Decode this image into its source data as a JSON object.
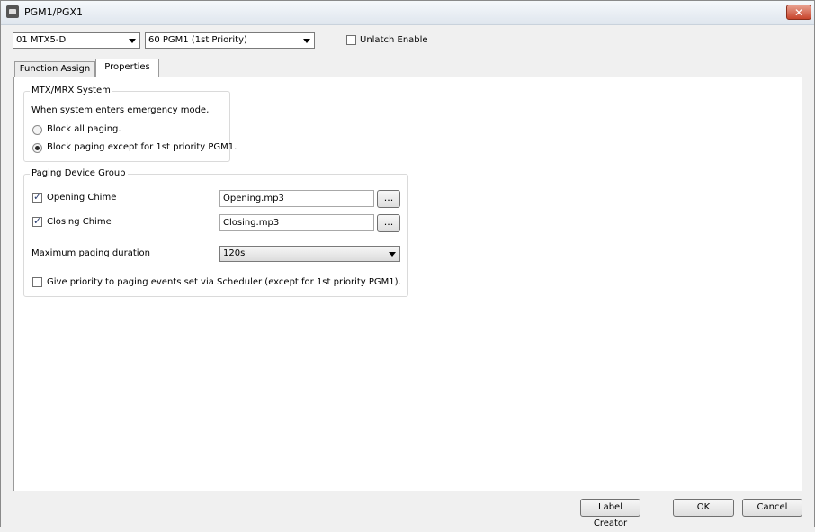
{
  "window": {
    "title": "PGM1/PGX1",
    "close_glyph": "✕"
  },
  "toolbar": {
    "device_select": "01 MTX5-D",
    "pgm_select": "60 PGM1 (1st Priority)",
    "unlatch_label": "Unlatch Enable",
    "unlatch_checked": false
  },
  "tabs": [
    {
      "label": "Function Assign",
      "active": false
    },
    {
      "label": "Properties",
      "active": true
    }
  ],
  "mtx_group": {
    "title": "MTX/MRX System",
    "description": "When system enters emergency mode,",
    "options": [
      {
        "label": "Block all paging.",
        "selected": false
      },
      {
        "label": "Block paging except for 1st priority PGM1.",
        "selected": true
      }
    ]
  },
  "paging_group": {
    "title": "Paging Device Group",
    "opening_chime": {
      "label": "Opening Chime",
      "checked": true,
      "file": "Opening.mp3",
      "browse": "..."
    },
    "closing_chime": {
      "label": "Closing Chime",
      "checked": true,
      "file": "Closing.mp3",
      "browse": "..."
    },
    "max_duration": {
      "label": "Maximum paging duration",
      "value": "120s"
    },
    "scheduler_priority": {
      "label": "Give priority to paging events set via Scheduler (except for 1st priority PGM1).",
      "checked": false
    }
  },
  "buttons": {
    "label_creator": "Label Creator",
    "ok": "OK",
    "cancel": "Cancel"
  }
}
